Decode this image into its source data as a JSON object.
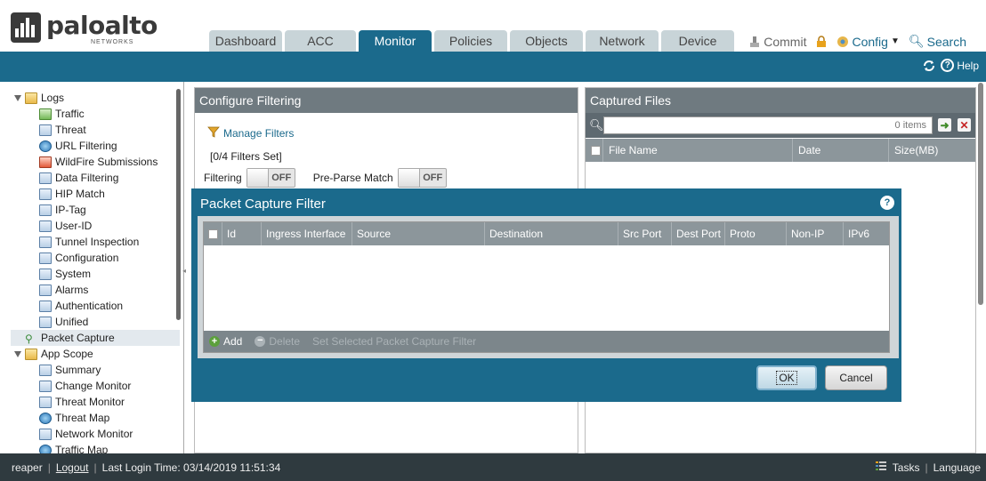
{
  "brand": {
    "name": "paloalto",
    "sub": "NETWORKS"
  },
  "tabs": [
    {
      "label": "Dashboard",
      "active": false
    },
    {
      "label": "ACC",
      "active": false
    },
    {
      "label": "Monitor",
      "active": true
    },
    {
      "label": "Policies",
      "active": false
    },
    {
      "label": "Objects",
      "active": false
    },
    {
      "label": "Network",
      "active": false
    },
    {
      "label": "Device",
      "active": false
    }
  ],
  "top_actions": {
    "commit": "Commit",
    "config": "Config",
    "search": "Search"
  },
  "bluebar": {
    "help": "Help"
  },
  "sidebar": {
    "items": [
      {
        "label": "Logs",
        "icon": "folder-icon",
        "level": 0,
        "expanded": true
      },
      {
        "label": "Traffic",
        "icon": "traffic-icon",
        "level": 1
      },
      {
        "label": "Threat",
        "icon": "threat-icon",
        "level": 1
      },
      {
        "label": "URL Filtering",
        "icon": "globe-icon",
        "level": 1
      },
      {
        "label": "WildFire Submissions",
        "icon": "wildfire-icon",
        "level": 1
      },
      {
        "label": "Data Filtering",
        "icon": "document-icon",
        "level": 1
      },
      {
        "label": "HIP Match",
        "icon": "document-icon",
        "level": 1
      },
      {
        "label": "IP-Tag",
        "icon": "tag-icon",
        "level": 1
      },
      {
        "label": "User-ID",
        "icon": "user-icon",
        "level": 1
      },
      {
        "label": "Tunnel Inspection",
        "icon": "tunnel-icon",
        "level": 1
      },
      {
        "label": "Configuration",
        "icon": "config-icon",
        "level": 1
      },
      {
        "label": "System",
        "icon": "system-icon",
        "level": 1
      },
      {
        "label": "Alarms",
        "icon": "alarm-icon",
        "level": 1
      },
      {
        "label": "Authentication",
        "icon": "auth-icon",
        "level": 1
      },
      {
        "label": "Unified",
        "icon": "document-icon",
        "level": 1
      },
      {
        "label": "Packet Capture",
        "icon": "packet-capture-icon",
        "level": 0,
        "selected": true
      },
      {
        "label": "App Scope",
        "icon": "folder-icon",
        "level": 0,
        "expanded": true
      },
      {
        "label": "Summary",
        "icon": "summary-icon",
        "level": 1
      },
      {
        "label": "Change Monitor",
        "icon": "chart-icon",
        "level": 1
      },
      {
        "label": "Threat Monitor",
        "icon": "chart-icon",
        "level": 1
      },
      {
        "label": "Threat Map",
        "icon": "globe-icon",
        "level": 1
      },
      {
        "label": "Network Monitor",
        "icon": "chart-icon",
        "level": 1
      },
      {
        "label": "Traffic Map",
        "icon": "globe-icon",
        "level": 1
      }
    ]
  },
  "configure_filtering": {
    "title": "Configure Filtering",
    "manage_filters": "Manage Filters",
    "filters_set": "[0/4 Filters Set]",
    "filtering_label": "Filtering",
    "filtering_state": "OFF",
    "preparse_label": "Pre-Parse Match",
    "preparse_state": "OFF"
  },
  "captured_files": {
    "title": "Captured Files",
    "items_count": "0 items",
    "columns": [
      "File Name",
      "Date",
      "Size(MB)"
    ]
  },
  "modal": {
    "title": "Packet Capture Filter",
    "columns": [
      "Id",
      "Ingress Interface",
      "Source",
      "Destination",
      "Src Port",
      "Dest Port",
      "Proto",
      "Non-IP",
      "IPv6"
    ],
    "add": "Add",
    "delete": "Delete",
    "set_selected": "Set Selected Packet Capture Filter",
    "ok": "OK",
    "cancel": "Cancel"
  },
  "footer": {
    "user": "reaper",
    "logout": "Logout",
    "last_login": "Last Login Time: 03/14/2019 11:51:34",
    "tasks": "Tasks",
    "language": "Language"
  },
  "colors": {
    "accent": "#1b6a8c",
    "header_gray": "#6f7a80",
    "footer": "#2f3a3f"
  }
}
